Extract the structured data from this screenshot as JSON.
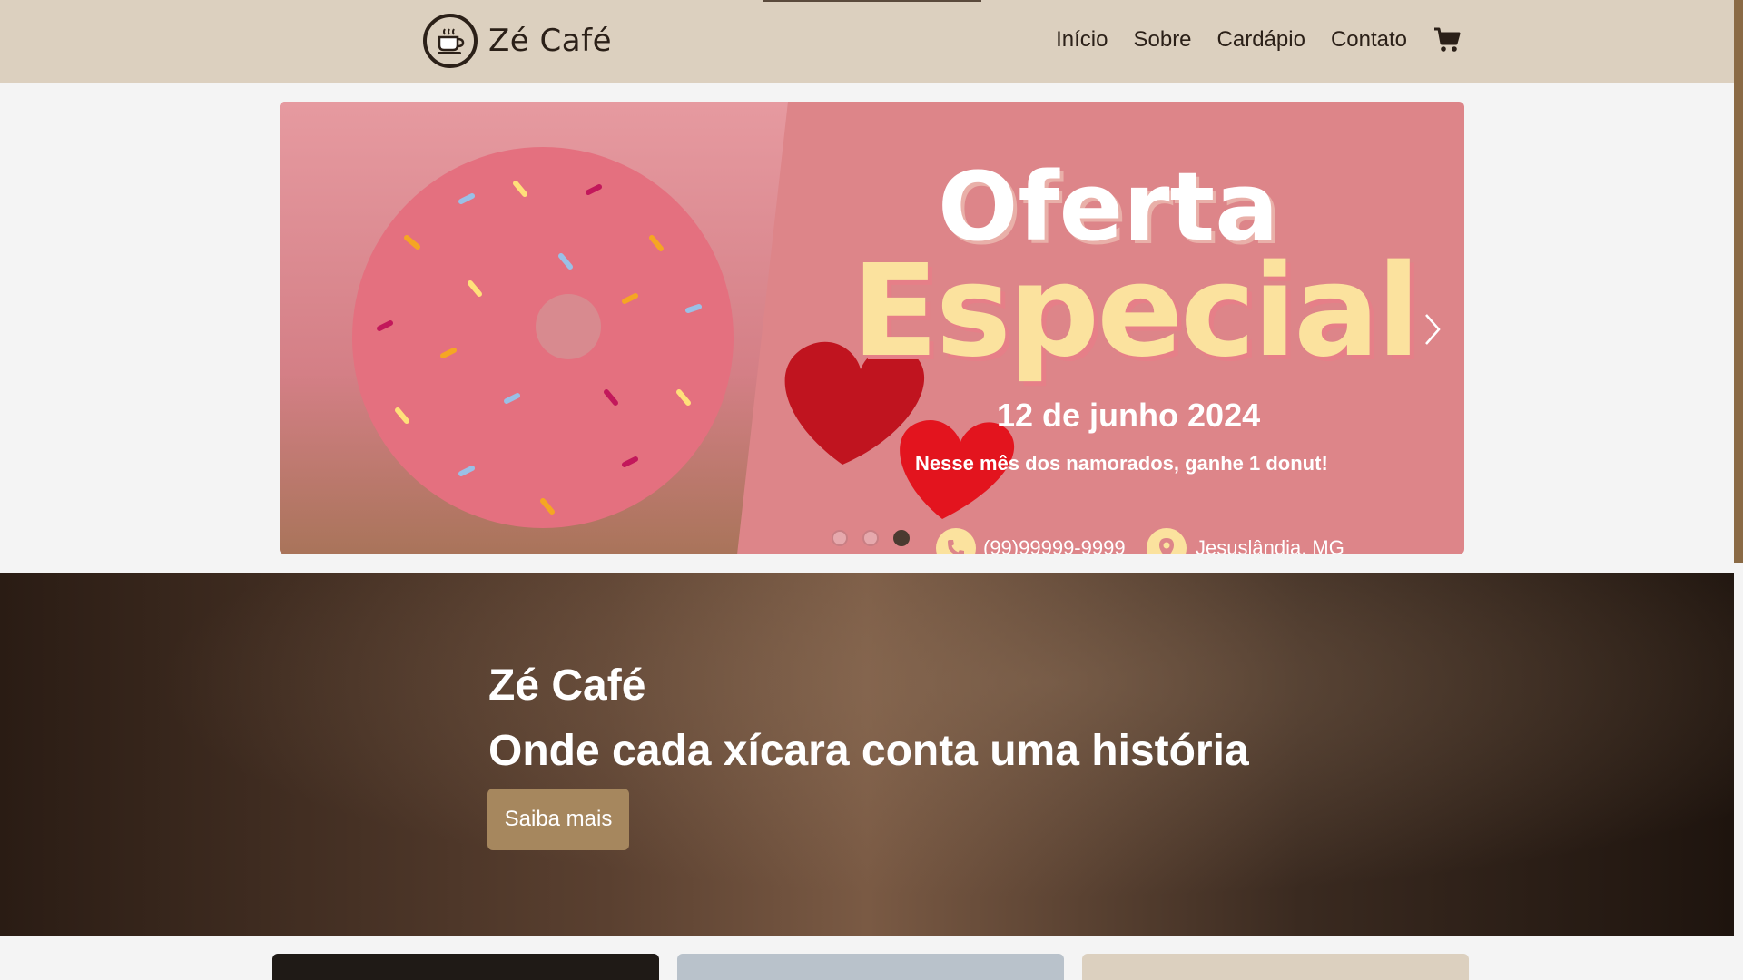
{
  "navbar": {
    "brand": "Zé Café",
    "links": [
      "Início",
      "Sobre",
      "Cardápio",
      "Contato"
    ]
  },
  "carousel": {
    "title": "Oferta",
    "subtitle": "Especial",
    "date": "12 de junho 2024",
    "description": "Nesse mês dos namorados, ganhe 1 donut!",
    "phone": "(99)99999-9999",
    "location": "Jesuslândia, MG",
    "active_index": 2
  },
  "hero": {
    "title": "Zé Café",
    "subtitle": "Onde cada xícara conta uma história",
    "button_label": "Saiba mais"
  },
  "colors": {
    "navbar": "#dcd0bf",
    "accent": "#a6875e",
    "carousel_bg": "#dd8589"
  },
  "icons": [
    "coffee-cup-icon",
    "cart-icon",
    "phone-icon",
    "location-pin-icon",
    "chevron-right-icon"
  ]
}
